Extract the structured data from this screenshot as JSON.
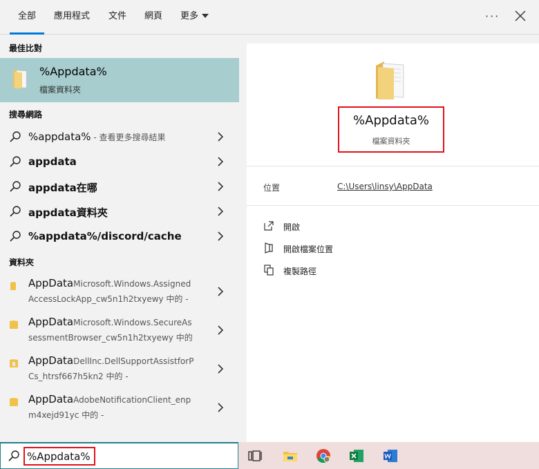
{
  "tabs": [
    {
      "label": "全部",
      "active": true
    },
    {
      "label": "應用程式"
    },
    {
      "label": "文件"
    },
    {
      "label": "網頁"
    },
    {
      "label": "更多"
    }
  ],
  "more_icon": "ellipsis-icon",
  "close_icon": "close-icon",
  "sections": {
    "best_match": "最佳比對",
    "web": "搜尋網路",
    "folders": "資料夾"
  },
  "best_match": {
    "title": "%Appdata%",
    "subtitle": "檔案資料夾"
  },
  "web_results": [
    {
      "bold": "",
      "text": "%appdata%",
      "hint": " - 查看更多搜尋結果"
    },
    {
      "bold": "appdata",
      "text": "",
      "hint": ""
    },
    {
      "bold": "appdata在哪",
      "text": "",
      "hint": ""
    },
    {
      "bold": "appdata資料夾",
      "text": "",
      "hint": ""
    },
    {
      "bold": "%appdata%/discord/cache",
      "text": "",
      "hint": ""
    }
  ],
  "folders": [
    {
      "name": "AppData",
      "path1": "Microsoft.Windows.Assigned",
      "line2": "AccessLockApp_cw5n1h2txyewy 中的 -"
    },
    {
      "name": "AppData",
      "path1": "Microsoft.Windows.SecureAs",
      "line2": "sessmentBrowser_cw5n1h2txyewy 中的"
    },
    {
      "name": "AppData",
      "path1": "DellInc.DellSupportAssistforP",
      "line2": "Cs_htrsf667h5kn2 中的 -"
    },
    {
      "name": "AppData",
      "path1": "AdobeNotificationClient_enp",
      "line2": "m4xejd91yc 中的 -"
    }
  ],
  "preview": {
    "title": "%Appdata%",
    "subtitle": "檔案資料夾",
    "location_label": "位置",
    "location_value": "C:\\Users\\linsy\\AppData",
    "actions": [
      {
        "label": "開啟",
        "icon": "open-icon"
      },
      {
        "label": "開啟檔案位置",
        "icon": "file-location-icon"
      },
      {
        "label": "複製路徑",
        "icon": "copy-icon"
      }
    ]
  },
  "search": {
    "value": "%Appdata%"
  },
  "taskbar": [
    "task-view-icon",
    "file-explorer-icon",
    "chrome-icon",
    "excel-icon",
    "word-icon"
  ],
  "colors": {
    "accent": "#0078d7",
    "selected": "#a7cdce",
    "highlight_box": "#e0101a"
  }
}
